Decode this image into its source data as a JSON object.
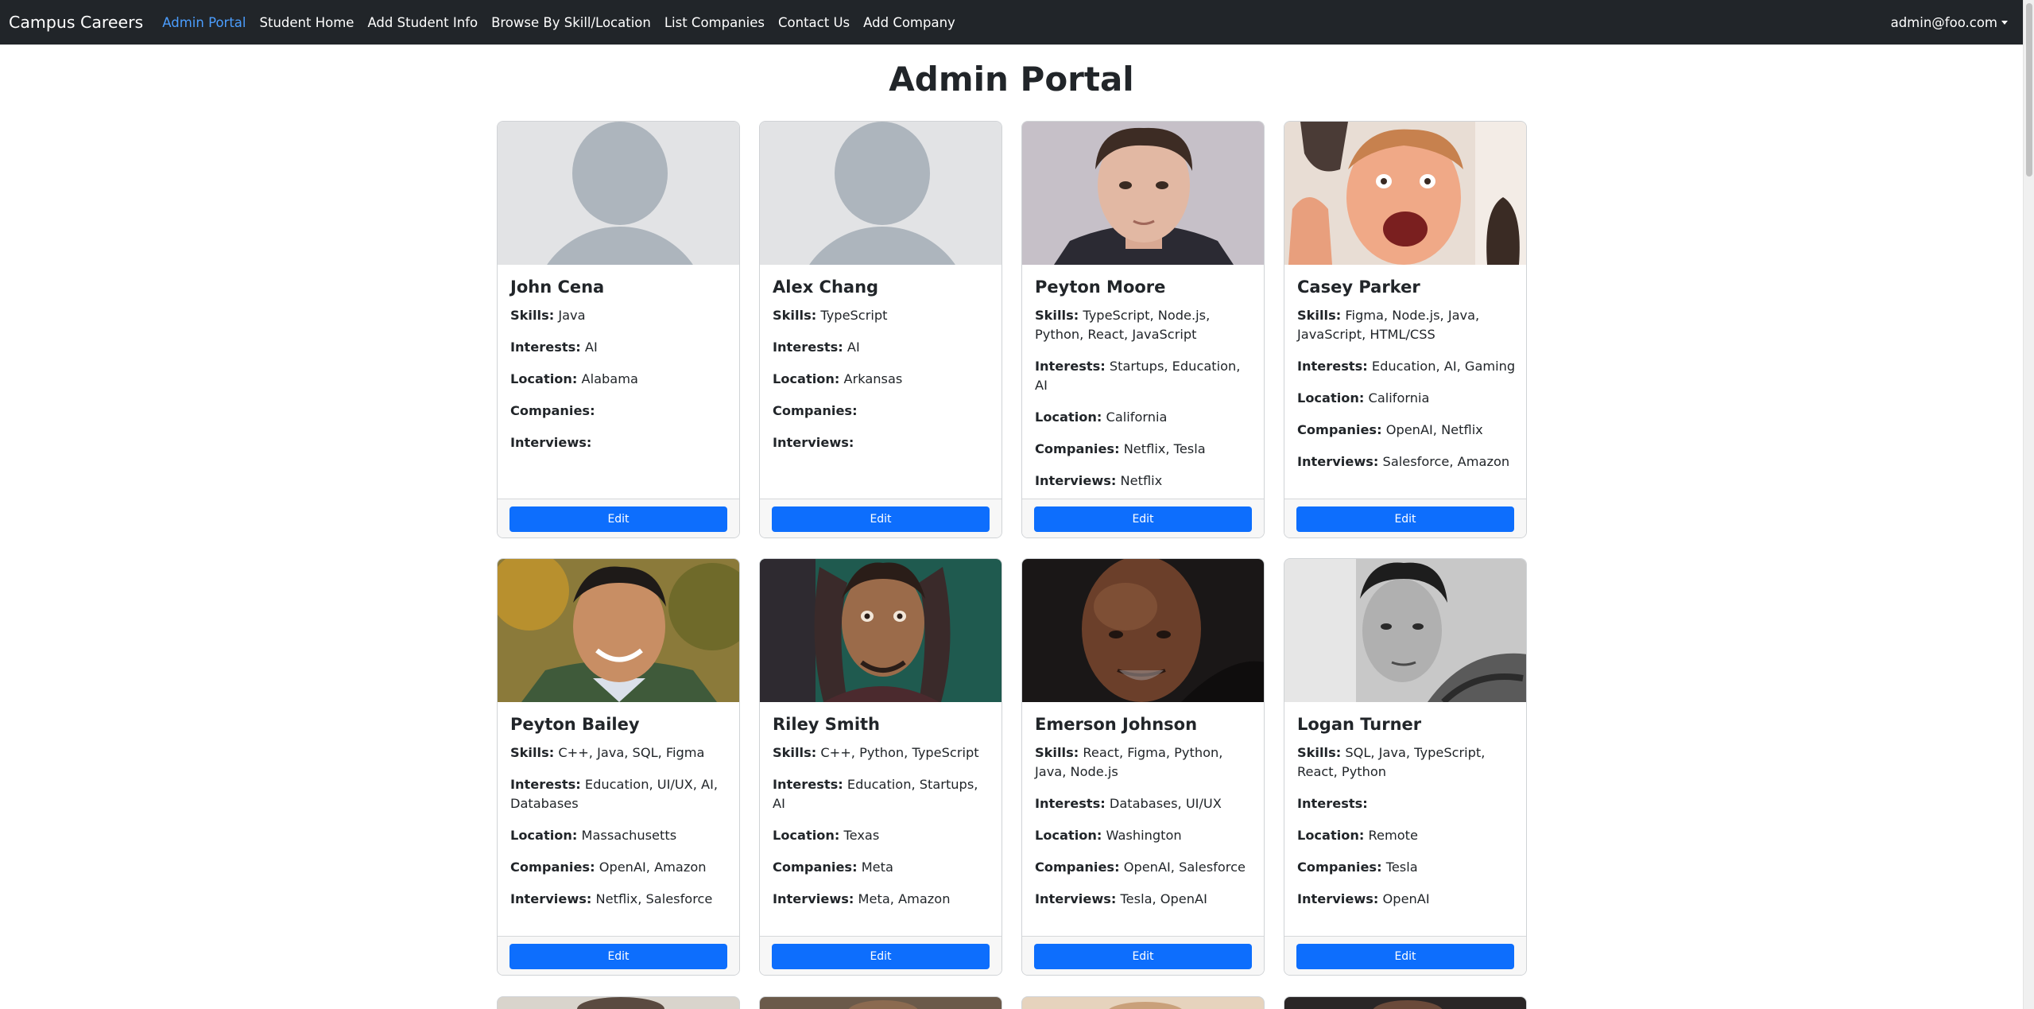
{
  "navbar": {
    "brand": "Campus Careers",
    "links": [
      "Admin Portal",
      "Student Home",
      "Add Student Info",
      "Browse By Skill/Location",
      "List Companies",
      "Contact Us",
      "Add Company"
    ],
    "user": "admin@foo.com",
    "colors": {
      "bg": "#212529",
      "active": "#4b9dfd"
    }
  },
  "page": {
    "title": "Admin Portal"
  },
  "labels": {
    "skills": "Skills:",
    "interests": "Interests:",
    "location": "Location:",
    "companies": "Companies:",
    "interviews": "Interviews:",
    "edit": "Edit"
  },
  "students": [
    {
      "name": "John Cena",
      "skills": "Java",
      "interests": "AI",
      "location": "Alabama",
      "companies": "",
      "interviews": ""
    },
    {
      "name": "Alex Chang",
      "skills": "TypeScript",
      "interests": "AI",
      "location": "Arkansas",
      "companies": "",
      "interviews": ""
    },
    {
      "name": "Peyton Moore",
      "skills": "TypeScript, Node.js, Python, React, JavaScript",
      "interests": "Startups, Education, AI",
      "location": "California",
      "companies": "Netflix, Tesla",
      "interviews": "Netflix"
    },
    {
      "name": "Casey Parker",
      "skills": "Figma, Node.js, Java, JavaScript, HTML/CSS",
      "interests": "Education, AI, Gaming",
      "location": "California",
      "companies": "OpenAI, Netflix",
      "interviews": "Salesforce, Amazon"
    },
    {
      "name": "Peyton Bailey",
      "skills": "C++, Java, SQL, Figma",
      "interests": "Education, UI/UX, AI, Databases",
      "location": "Massachusetts",
      "companies": "OpenAI, Amazon",
      "interviews": "Netflix, Salesforce"
    },
    {
      "name": "Riley Smith",
      "skills": "C++, Python, TypeScript",
      "interests": "Education, Startups, AI",
      "location": "Texas",
      "companies": "Meta",
      "interviews": "Meta, Amazon"
    },
    {
      "name": "Emerson Johnson",
      "skills": "React, Figma, Python, Java, Node.js",
      "interests": "Databases, UI/UX",
      "location": "Washington",
      "companies": "OpenAI, Salesforce",
      "interviews": "Tesla, OpenAI"
    },
    {
      "name": "Logan Turner",
      "skills": "SQL, Java, TypeScript, React, Python",
      "interests": "",
      "location": "Remote",
      "companies": "Tesla",
      "interviews": "OpenAI"
    }
  ],
  "icons": {
    "avatar_placeholder": "default-avatar-icon",
    "user_caret": "caret-down-icon"
  }
}
